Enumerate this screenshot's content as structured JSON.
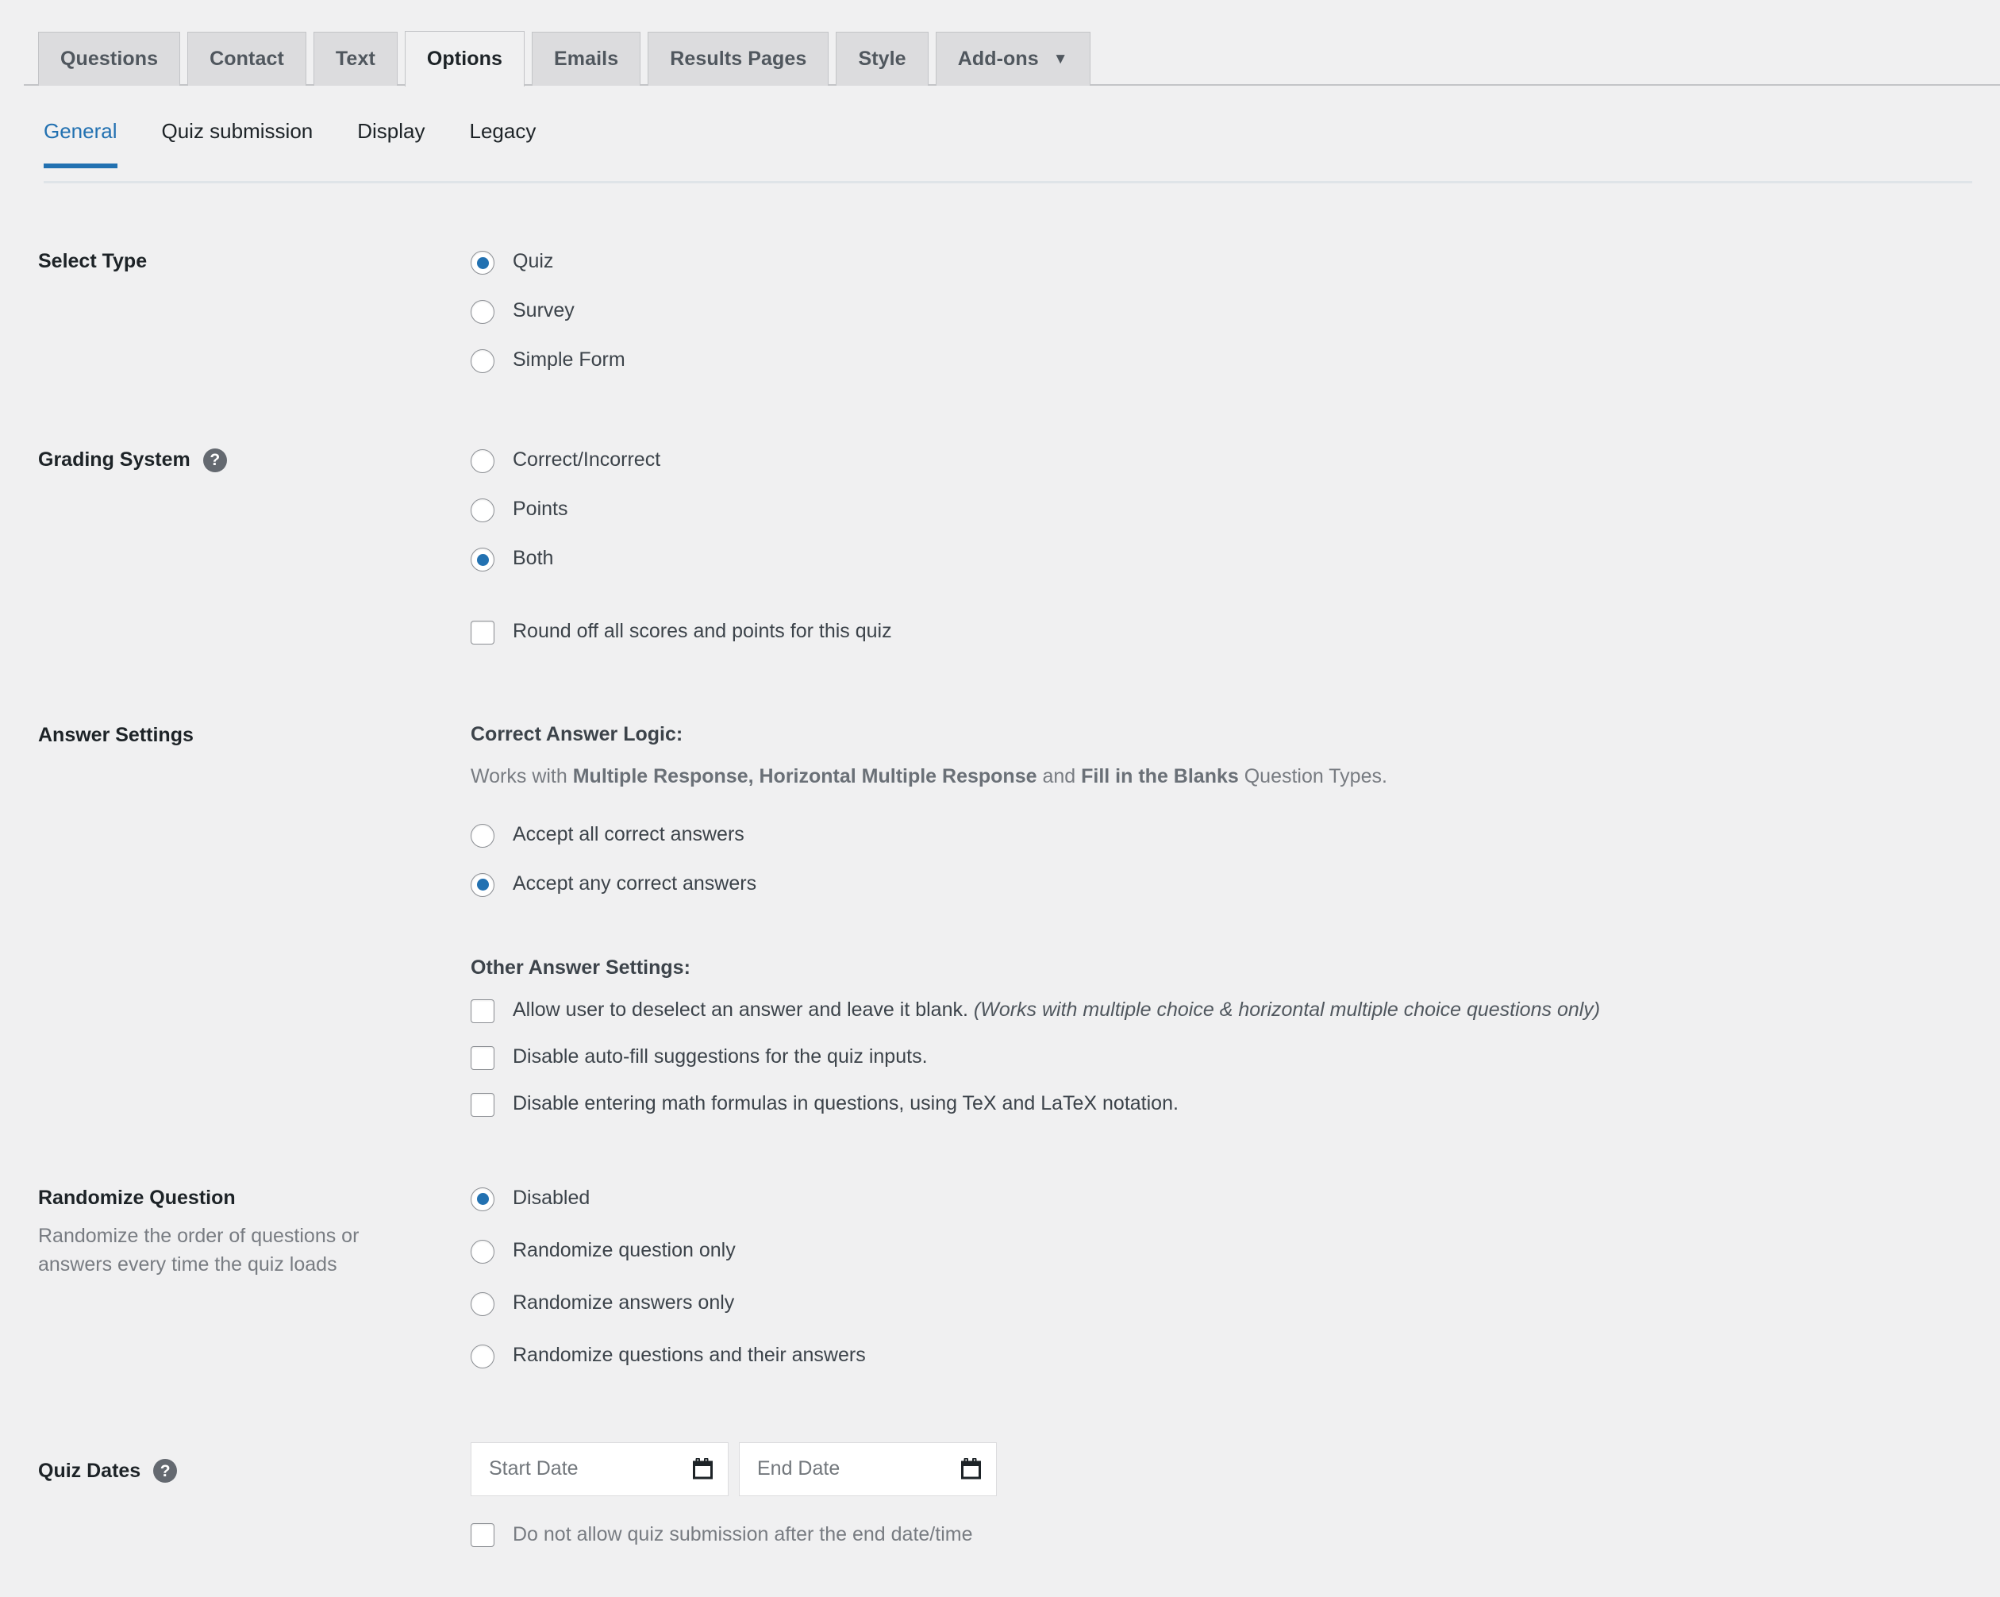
{
  "tabs": [
    {
      "label": "Questions",
      "active": false
    },
    {
      "label": "Contact",
      "active": false
    },
    {
      "label": "Text",
      "active": false
    },
    {
      "label": "Options",
      "active": true
    },
    {
      "label": "Emails",
      "active": false
    },
    {
      "label": "Results Pages",
      "active": false
    },
    {
      "label": "Style",
      "active": false
    },
    {
      "label": "Add-ons",
      "active": false,
      "caret": "▼"
    }
  ],
  "subnav": [
    {
      "label": "General",
      "active": true
    },
    {
      "label": "Quiz submission",
      "active": false
    },
    {
      "label": "Display",
      "active": false
    },
    {
      "label": "Legacy",
      "active": false
    }
  ],
  "help_glyph": "?",
  "select_type": {
    "label": "Select Type",
    "options": [
      {
        "label": "Quiz",
        "checked": true
      },
      {
        "label": "Survey",
        "checked": false
      },
      {
        "label": "Simple Form",
        "checked": false
      }
    ]
  },
  "grading_system": {
    "label": "Grading System",
    "options": [
      {
        "label": "Correct/Incorrect",
        "checked": false
      },
      {
        "label": "Points",
        "checked": false
      },
      {
        "label": "Both",
        "checked": true
      }
    ],
    "round_off": {
      "label": "Round off all scores and points for this quiz",
      "checked": false
    }
  },
  "answer_settings": {
    "label": "Answer Settings",
    "correct_logic_heading": "Correct Answer Logic:",
    "correct_logic_note_pre": "Works with ",
    "correct_logic_note_b1": "Multiple Response, Horizontal Multiple Response",
    "correct_logic_note_mid": " and ",
    "correct_logic_note_b2": "Fill in the Blanks",
    "correct_logic_note_post": " Question Types.",
    "logic_options": [
      {
        "label": "Accept all correct answers",
        "checked": false
      },
      {
        "label": "Accept any correct answers",
        "checked": true
      }
    ],
    "other_heading": "Other Answer Settings:",
    "other_options": [
      {
        "label": "Allow user to deselect an answer and leave it blank.",
        "note": "(Works with multiple choice & horizontal multiple choice questions only)",
        "checked": false
      },
      {
        "label": "Disable auto-fill suggestions for the quiz inputs.",
        "note": "",
        "checked": false
      },
      {
        "label": "Disable entering math formulas in questions, using TeX and LaTeX notation.",
        "note": "",
        "checked": false
      }
    ]
  },
  "randomize": {
    "label": "Randomize Question",
    "description": "Randomize the order of questions or answers every time the quiz loads",
    "options": [
      {
        "label": "Disabled",
        "checked": true
      },
      {
        "label": "Randomize question only",
        "checked": false
      },
      {
        "label": "Randomize answers only",
        "checked": false
      },
      {
        "label": "Randomize questions and their answers",
        "checked": false
      }
    ]
  },
  "quiz_dates": {
    "label": "Quiz Dates",
    "start_placeholder": "Start Date",
    "start_value": "",
    "end_placeholder": "End Date",
    "end_value": "",
    "no_submit_after_end": {
      "label": "Do not allow quiz submission after the end date/time",
      "checked": false
    }
  },
  "colors": {
    "accent": "#2271b1",
    "page_bg": "#f0f0f1",
    "tab_bg": "#dcdcde",
    "border": "#c3c4c7",
    "text": "#3c434a",
    "muted": "#787c82"
  }
}
